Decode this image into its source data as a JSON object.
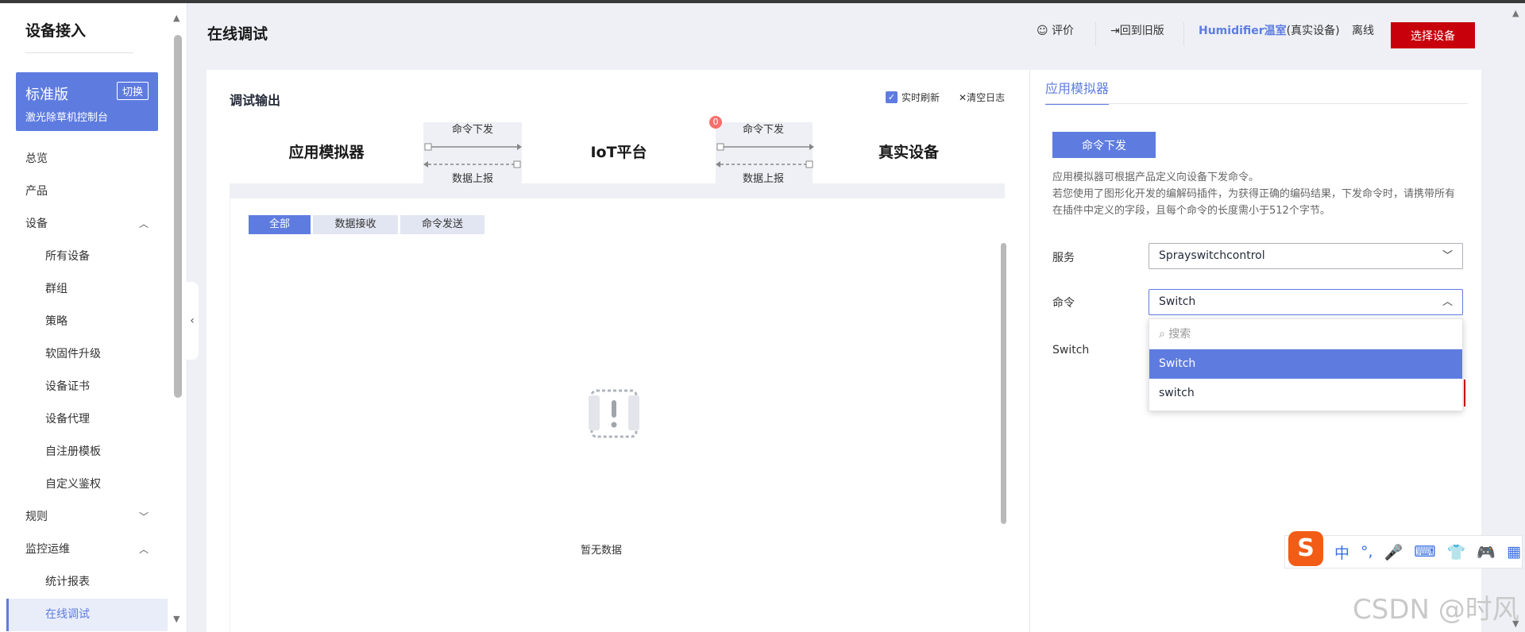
{
  "sidebar": {
    "title": "设备接入",
    "edition": {
      "name": "标准版",
      "switch_label": "切换",
      "subtitle": "激光除草机控制台"
    },
    "items": [
      {
        "label": "总览",
        "level": 1,
        "chevron": ""
      },
      {
        "label": "产品",
        "level": 1,
        "chevron": ""
      },
      {
        "label": "设备",
        "level": 1,
        "chevron": "^"
      },
      {
        "label": "所有设备",
        "level": 2,
        "chevron": ""
      },
      {
        "label": "群组",
        "level": 2,
        "chevron": ""
      },
      {
        "label": "策略",
        "level": 2,
        "chevron": ""
      },
      {
        "label": "软固件升级",
        "level": 2,
        "chevron": ""
      },
      {
        "label": "设备证书",
        "level": 2,
        "chevron": ""
      },
      {
        "label": "设备代理",
        "level": 2,
        "chevron": ""
      },
      {
        "label": "自注册模板",
        "level": 2,
        "chevron": ""
      },
      {
        "label": "自定义鉴权",
        "level": 2,
        "chevron": ""
      },
      {
        "label": "规则",
        "level": 1,
        "chevron": "v"
      },
      {
        "label": "监控运维",
        "level": 1,
        "chevron": "^"
      },
      {
        "label": "统计报表",
        "level": 2,
        "chevron": ""
      },
      {
        "label": "在线调试",
        "level": 2,
        "chevron": "",
        "active": true
      }
    ]
  },
  "header": {
    "title": "在线调试",
    "rate_label": "评价",
    "back_label": "回到旧版",
    "device_name": "Humidifier温室",
    "device_type": "(真实设备)",
    "status": "离线",
    "select_device_label": "选择设备"
  },
  "debug": {
    "title": "调试输出",
    "realtime_refresh": "实时刷新",
    "clear_log": "清空日志",
    "flow": {
      "box1": "应用模拟器",
      "box2": "IoT平台",
      "box3": "真实设备",
      "down_label_1": "命令下发",
      "up_label_1": "数据上报",
      "down_label_2": "命令下发",
      "up_label_2": "数据上报",
      "badge": "0"
    },
    "tabs": [
      "全部",
      "数据接收",
      "命令发送"
    ],
    "empty_text": "暂无数据"
  },
  "simulator": {
    "tab": "应用模拟器",
    "send_button": "命令下发",
    "desc_line1": "应用模拟器可根据产品定义向设备下发命令。",
    "desc_line2": "若您使用了图形化开发的编解码插件，为获得正确的编码结果，下发命令时，请携带所有在插件中定义的字段，且每个命令的长度需小于512个字节。",
    "service_label": "服务",
    "service_value": "Sprayswitchcontrol",
    "command_label": "命令",
    "command_value": "Switch",
    "param_label": "Switch",
    "dropdown": {
      "search_placeholder": "搜索",
      "options": [
        "Switch",
        "switch"
      ],
      "selected_index": 0
    }
  },
  "ime": {
    "logo": "S",
    "items": [
      "中",
      "°,",
      "mic-icon",
      "keyboard-icon",
      "shirt-icon",
      "gamepad-icon",
      "apps-icon"
    ]
  },
  "watermark": "CSDN @时风",
  "colors": {
    "primary": "#5e7ce0",
    "danger": "#c7000b",
    "badge": "#f66f6a"
  }
}
